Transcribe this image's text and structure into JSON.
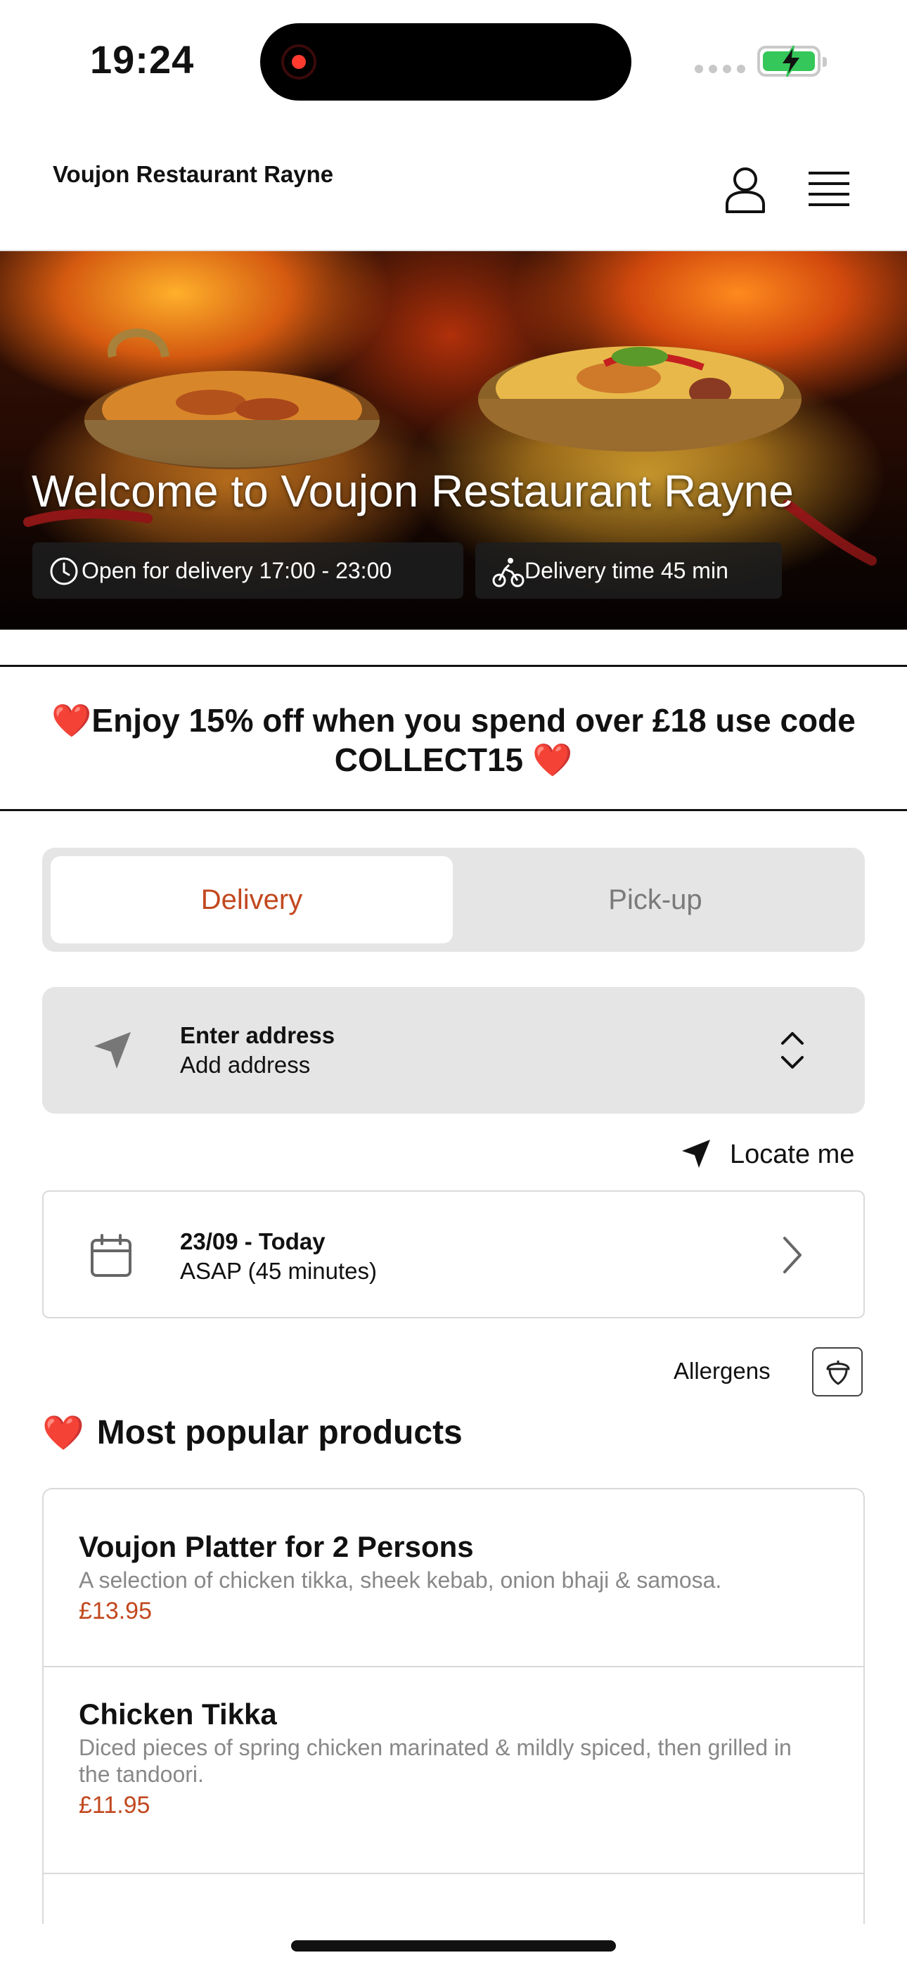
{
  "status_bar": {
    "time": "19:24"
  },
  "header": {
    "restaurant_name": "Voujon Restaurant Rayne"
  },
  "hero": {
    "title": "Welcome to Voujon Restaurant Rayne",
    "open_hours": "Open for delivery 17:00 - 23:00",
    "delivery_time": "Delivery time 45 min"
  },
  "promo": {
    "emoji": "❤️",
    "text": "Enjoy 15% off when you spend over £18 use code COLLECT15"
  },
  "order_type": {
    "options": [
      "Delivery",
      "Pick-up"
    ],
    "selected": "Delivery",
    "accent": "#c2481f"
  },
  "address": {
    "label": "Enter address",
    "value": "Add address"
  },
  "locate": {
    "label": "Locate me"
  },
  "schedule": {
    "date": "23/09 - Today",
    "time": "ASAP (45 minutes)"
  },
  "allergens": {
    "label": "Allergens"
  },
  "popular": {
    "emoji": "❤️",
    "title": "Most popular products",
    "products": [
      {
        "name": "Voujon Platter for 2 Persons",
        "description": "A selection of chicken tikka, sheek kebab, onion bhaji & samosa.",
        "price": "£13.95"
      },
      {
        "name": "Chicken Tikka",
        "description": "Diced pieces of spring chicken marinated & mildly spiced, then grilled in the tandoori.",
        "price": "£11.95"
      }
    ]
  }
}
